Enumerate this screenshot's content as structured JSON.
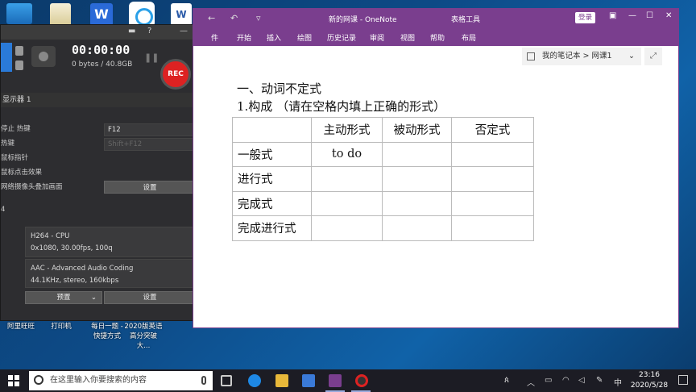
{
  "desktop": {
    "labels": [
      "阿里旺旺",
      "打印机",
      "每日一题 - 快捷方式",
      "2020版英语高分突破大..."
    ]
  },
  "recorder": {
    "timer": "00:00:00",
    "bytes": "0 bytes / 40.8GB",
    "rec_label": "REC",
    "section1": "显示器 1",
    "rows": [
      {
        "label": "停止 热键",
        "value": "F12"
      },
      {
        "label": "热键",
        "value": "Shift+F12"
      },
      {
        "label": "鼠标指针"
      },
      {
        "label": "鼠标点击效果"
      },
      {
        "label": "网络摄像头叠加画面",
        "button": "设置"
      }
    ],
    "section2": "4",
    "video_codec": {
      "name": "H264 - CPU",
      "detail": "0x1080, 30.00fps, 100q"
    },
    "audio_codec": {
      "name": "AAC - Advanced Audio Coding",
      "detail": "44.1KHz, stereo, 160kbps"
    },
    "preset_button": "预置",
    "settings_button": "设置"
  },
  "onenote": {
    "title": "新的网课 - OneNote",
    "tools_tab": "表格工具",
    "login": "登录",
    "ribbon_tabs": [
      "件",
      "开始",
      "插入",
      "绘图",
      "历史记录",
      "审阅",
      "视图",
      "帮助",
      "布局"
    ],
    "breadcrumb": "我的笔记本 > 网课1",
    "heading1": "一、动词不定式",
    "heading2": "1.构成 （请在空格内填上正确的形式）",
    "table": [
      [
        "",
        "主动形式",
        "被动形式",
        "否定式"
      ],
      [
        "一般式",
        "to do",
        "",
        ""
      ],
      [
        "进行式",
        "",
        "",
        ""
      ],
      [
        "完成式",
        "",
        "",
        ""
      ],
      [
        "完成进行式",
        "",
        "",
        ""
      ]
    ]
  },
  "taskbar": {
    "search_placeholder": "在这里输入你要搜索的内容",
    "ime": "中",
    "time": "23:16",
    "date": "2020/5/28"
  }
}
